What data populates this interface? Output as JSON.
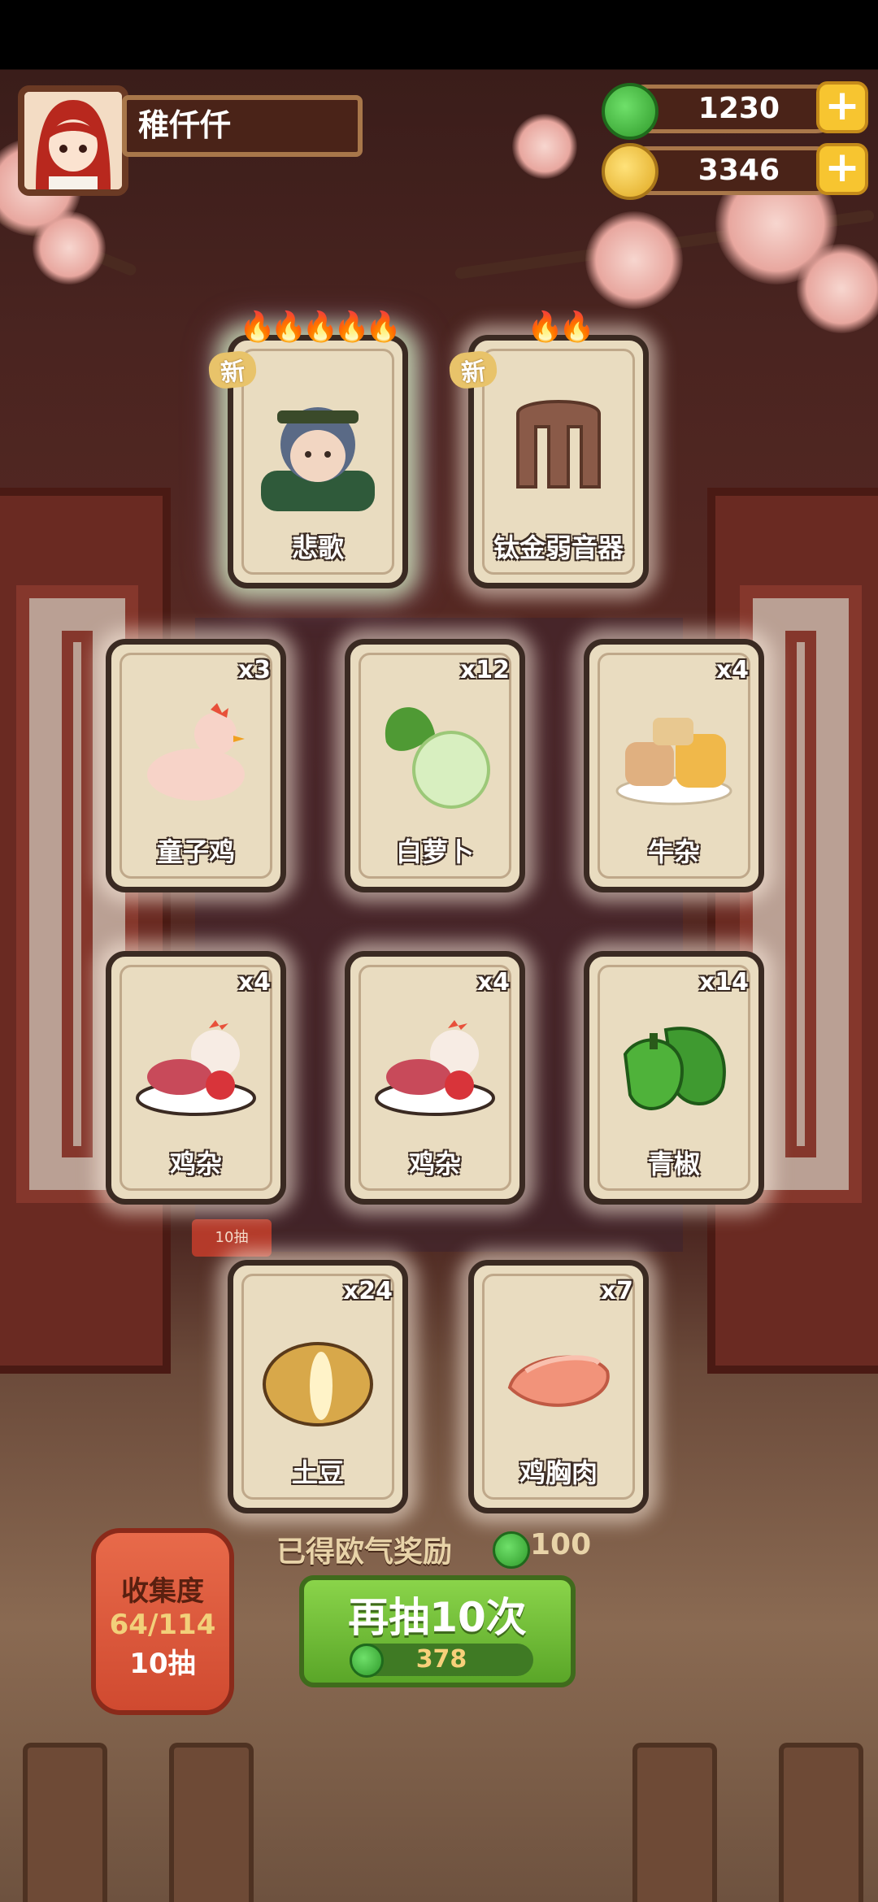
{
  "player": {
    "name": "稚仟仟"
  },
  "resources": {
    "jade": {
      "value": "1230",
      "icon": "jade-coin-icon"
    },
    "gold": {
      "value": "3346",
      "icon": "gold-coin-icon"
    }
  },
  "new_label": "新",
  "featured_cards": [
    {
      "label": "悲歌",
      "is_new": true,
      "stars": 5
    },
    {
      "label": "钛金弱音器",
      "is_new": true,
      "stars": 2
    }
  ],
  "cards": [
    {
      "label": "童子鸡",
      "qty": "x3"
    },
    {
      "label": "白萝卜",
      "qty": "x12"
    },
    {
      "label": "牛杂",
      "qty": "x4"
    },
    {
      "label": "鸡杂",
      "qty": "x4"
    },
    {
      "label": "鸡杂",
      "qty": "x4"
    },
    {
      "label": "青椒",
      "qty": "x14"
    },
    {
      "label": "土豆",
      "qty": "x24"
    },
    {
      "label": "鸡胸肉",
      "qty": "x7"
    }
  ],
  "background_tag": "10抽",
  "bonus": {
    "label": "已得欧气奖励",
    "value": "100"
  },
  "draw_button": {
    "label": "再抽10次",
    "cost": "378"
  },
  "collection": {
    "title": "收集度",
    "progress": "64/114",
    "draws": "10抽"
  }
}
